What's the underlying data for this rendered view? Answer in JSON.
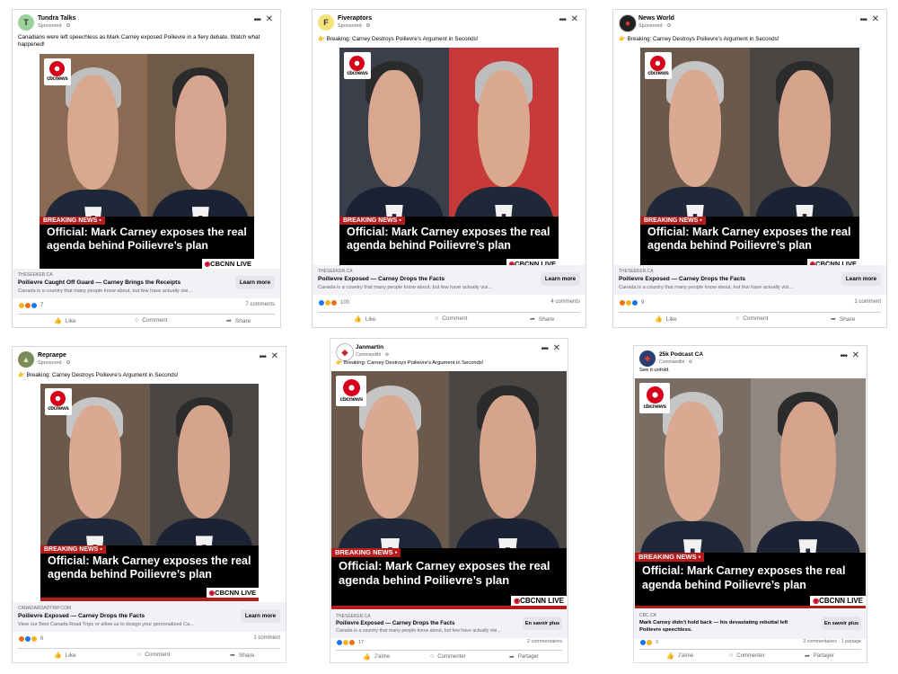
{
  "colors": {
    "breaking_red": "#b71c1c",
    "cbc_red": "#d7001b",
    "like_blue": "#1877f2",
    "haha_yellow": "#f7b125",
    "angry_orange": "#e9710f",
    "love_red": "#f33e58"
  },
  "posts": [
    {
      "page": "Tundra Talks",
      "sponsored": "Sponsored · ⚙",
      "avatar": "T",
      "caption": "Canadians were left speechless as Mark Carney exposed Poilievre in a fiery debate. Watch what happened!",
      "cbc_logo": "cbcnews",
      "breaking": "BREAKING NEWS ▪",
      "headline": "Official: Mark Carney exposes the real agenda behind Poilievre’s plan",
      "network": "CBCNN LIVE",
      "domain": "THESEEKER.CA",
      "link_title": "Poilievre Caught Off Guard — Carney Brings the Receipts",
      "link_desc": "Canada is a country that many people know about, but few have actually visi...",
      "cta": "Learn more",
      "reaction_count": "7",
      "comment_count": "7 comments",
      "like": "Like",
      "comment": "Comment",
      "share": "Share"
    },
    {
      "page": "Fiveraptors",
      "sponsored": "Sponsored · ⚙",
      "avatar": "F",
      "caption": "👉 Breaking: Carney Destroys Poilievre’s Argument in Seconds!",
      "cbc_logo": "cbcnews",
      "breaking": "BREAKING NEWS ▪",
      "headline": "Official: Mark Carney exposes the real agenda behind Poilievre’s plan",
      "network": "CBCNN LIVE",
      "domain": "THESEEKER.CA",
      "link_title": "Poilievre Exposed — Carney Drops the Facts",
      "link_desc": "Canada is a country that many people know about, but few have actually visi...",
      "cta": "Learn more",
      "reaction_count": "100",
      "comment_count": "4 comments",
      "like": "Like",
      "comment": "Comment",
      "share": "Share"
    },
    {
      "page": "News World",
      "sponsored": "Sponsored · ⚙",
      "avatar": "",
      "caption": "👉 Breaking: Carney Destroys Poilievre’s Argument in Seconds!",
      "cbc_logo": "cbcnews",
      "breaking": "BREAKING NEWS ▪",
      "headline": "Official: Mark Carney exposes the real agenda behind Poilievre’s plan",
      "network": "CBCNN LIVE",
      "domain": "THESEEKER.CA",
      "link_title": "Poilievre Exposed — Carney Drops the Facts",
      "link_desc": "Canada is a country that many people know about, but few have actually visi...",
      "cta": "Learn more",
      "reaction_count": "9",
      "comment_count": "1 comment",
      "like": "Like",
      "comment": "Comment",
      "share": "Share"
    },
    {
      "page": "Repraepe",
      "sponsored": "Sponsored · ⚙",
      "avatar": "",
      "caption": "👉 Breaking: Carney Destroys Poilievre’s Argument in Seconds!",
      "cbc_logo": "cbcnews",
      "breaking": "BREAKING NEWS ▪",
      "headline": "Official: Mark Carney exposes the real agenda behind Poilievre’s plan",
      "network": "CBCNN LIVE",
      "domain": "CANADAROADTRIP.COM",
      "link_title": "Poilievre Exposed — Carney Drops the Facts",
      "link_desc": "View our Best Canada Road Trips or allow us to design your personalized Ca...",
      "cta": "Learn more",
      "reaction_count": "6",
      "comment_count": "1 comment",
      "like": "Like",
      "comment": "Comment",
      "share": "Share"
    },
    {
      "page": "Janmartin",
      "sponsored": "Commandité · ⚙",
      "avatar": "",
      "caption": "👉 Breaking: Carney Destroys Poilievre’s Argument in Seconds!",
      "cbc_logo": "cbcnews",
      "breaking": "BREAKING NEWS ▪",
      "headline": "Official: Mark Carney exposes the real agenda behind Poilievre’s plan",
      "network": "CBCNN LIVE",
      "domain": "THESEEKER.CA",
      "link_title": "Poilievre Exposed — Carney Drops the Facts",
      "link_desc": "Canada is a country that many people know about, but few have actually visi...",
      "cta": "En savoir plus",
      "reaction_count": "17",
      "comment_count": "2 commentaires",
      "like": "J’aime",
      "comment": "Commenter",
      "share": "Partager"
    },
    {
      "page": "25k Podcast CA",
      "sponsored": "Commandité · ⚙",
      "avatar": "",
      "caption": "See it unfold.",
      "cbc_logo": "cbcnews",
      "breaking": "BREAKING NEWS ▪",
      "headline": "Official: Mark Carney exposes the real agenda behind Poilievre’s plan",
      "network": "CBCNN LIVE",
      "domain": "CBC.CA",
      "link_title": "Mark Carney didn’t hold back — his devastating rebuttal left Poilievre speechless.",
      "link_desc": "",
      "cta": "En savoir plus",
      "reaction_count": "3",
      "comment_count": "3 commentaires · 1 partage",
      "like": "J’aime",
      "comment": "Commenter",
      "share": "Partager"
    }
  ]
}
